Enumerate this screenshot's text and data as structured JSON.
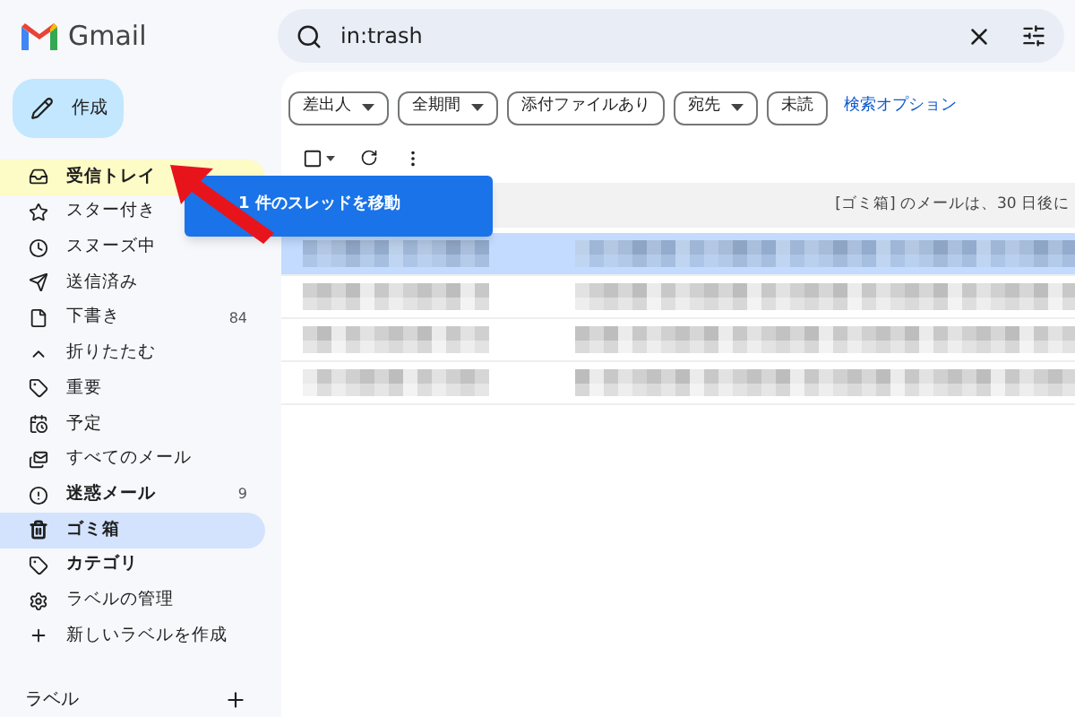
{
  "app": {
    "name": "Gmail"
  },
  "search": {
    "value": "in:trash"
  },
  "compose": {
    "label": "作成"
  },
  "sidebar": {
    "items": [
      {
        "label": "受信トレイ",
        "bold": true,
        "highlighted": true,
        "selected": false
      },
      {
        "label": "スター付き",
        "bold": false,
        "highlighted": false,
        "selected": false
      },
      {
        "label": "スヌーズ中",
        "bold": false,
        "highlighted": false,
        "selected": false
      },
      {
        "label": "送信済み",
        "bold": false,
        "highlighted": false,
        "selected": false
      },
      {
        "label": "下書き",
        "count": "84",
        "bold": false,
        "highlighted": false,
        "selected": false
      },
      {
        "label": "折りたたむ",
        "bold": false,
        "highlighted": false,
        "selected": false
      },
      {
        "label": "重要",
        "bold": false,
        "highlighted": false,
        "selected": false
      },
      {
        "label": "予定",
        "bold": false,
        "highlighted": false,
        "selected": false
      },
      {
        "label": "すべてのメール",
        "bold": false,
        "highlighted": false,
        "selected": false
      },
      {
        "label": "迷惑メール",
        "count": "9",
        "bold": true,
        "highlighted": false,
        "selected": false
      },
      {
        "label": "ゴミ箱",
        "bold": true,
        "highlighted": false,
        "selected": true
      },
      {
        "label": "カテゴリ",
        "bold": true,
        "highlighted": false,
        "selected": false
      },
      {
        "label": "ラベルの管理",
        "bold": false,
        "highlighted": false,
        "selected": false
      },
      {
        "label": "新しいラベルを作成",
        "bold": false,
        "highlighted": false,
        "selected": false
      }
    ],
    "labels_heading": "ラベル"
  },
  "filters": [
    {
      "label": "差出人",
      "dropdown": true
    },
    {
      "label": "全期間",
      "dropdown": true
    },
    {
      "label": "添付ファイルあり",
      "dropdown": false
    },
    {
      "label": "宛先",
      "dropdown": true
    },
    {
      "label": "未読",
      "dropdown": false
    }
  ],
  "advanced_search": "検索オプション",
  "notice": "[ゴミ箱] のメールは、30 日後に",
  "drag_tooltip": "1 件のスレッドを移動",
  "rows": [
    {
      "selected": true
    },
    {
      "selected": false
    },
    {
      "selected": false
    },
    {
      "selected": false
    }
  ]
}
